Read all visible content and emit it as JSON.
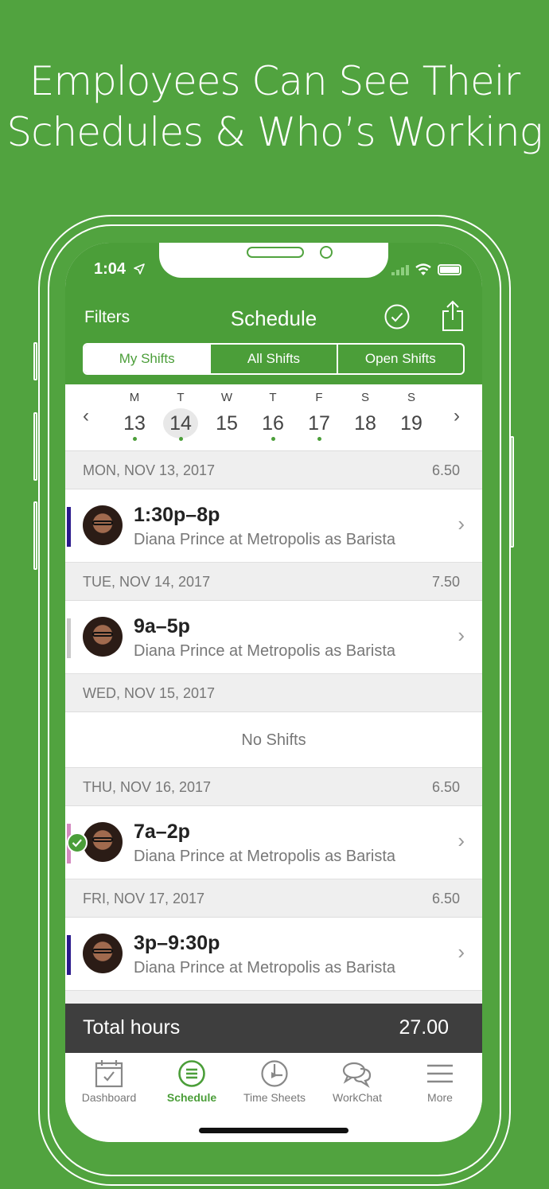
{
  "headline": {
    "line1": "Employees Can See Their",
    "line2": "Schedules & Who’s Working"
  },
  "status": {
    "time": "1:04"
  },
  "nav": {
    "filters_label": "Filters",
    "title": "Schedule",
    "segments": [
      "My Shifts",
      "All Shifts",
      "Open Shifts"
    ],
    "active_segment": "My Shifts"
  },
  "week": {
    "days": [
      {
        "letter": "M",
        "num": "13"
      },
      {
        "letter": "T",
        "num": "14"
      },
      {
        "letter": "W",
        "num": "15"
      },
      {
        "letter": "T",
        "num": "16"
      },
      {
        "letter": "F",
        "num": "17"
      },
      {
        "letter": "S",
        "num": "18"
      },
      {
        "letter": "S",
        "num": "19"
      }
    ],
    "selected_day": "14",
    "days_with_shifts": [
      "13",
      "14",
      "16",
      "17"
    ]
  },
  "sections": [
    {
      "date": "MON, NOV 13, 2017",
      "hours": "6.50",
      "shift": {
        "time": "1:30p–8p",
        "detail": "Diana Prince at Metropolis as Barista",
        "color": "#2a1a8c"
      }
    },
    {
      "date": "TUE, NOV 14, 2017",
      "hours": "7.50",
      "shift": {
        "time": "9a–5p",
        "detail": "Diana Prince at Metropolis as Barista",
        "color": "#c9c9c9"
      }
    },
    {
      "date": "WED, NOV 15, 2017",
      "hours": "",
      "empty_text": "No Shifts"
    },
    {
      "date": "THU, NOV 16, 2017",
      "hours": "6.50",
      "shift": {
        "time": "7a–2p",
        "detail": "Diana Prince at Metropolis as Barista",
        "color": "#d48ac0",
        "confirmed": true
      }
    },
    {
      "date": "FRI, NOV 17, 2017",
      "hours": "6.50",
      "shift": {
        "time": "3p–9:30p",
        "detail": "Diana Prince at Metropolis as Barista",
        "color": "#2a1a8c"
      }
    }
  ],
  "total": {
    "label": "Total hours",
    "value": "27.00"
  },
  "tabs": [
    {
      "label": "Dashboard",
      "icon": "calendar-check-icon"
    },
    {
      "label": "Schedule",
      "icon": "list-circle-icon"
    },
    {
      "label": "Time Sheets",
      "icon": "clock-flag-icon"
    },
    {
      "label": "WorkChat",
      "icon": "chat-bubbles-icon"
    },
    {
      "label": "More",
      "icon": "hamburger-icon"
    }
  ],
  "active_tab": "Schedule",
  "colors": {
    "brand_green": "#4b9e39",
    "background_green": "#51a33f"
  }
}
